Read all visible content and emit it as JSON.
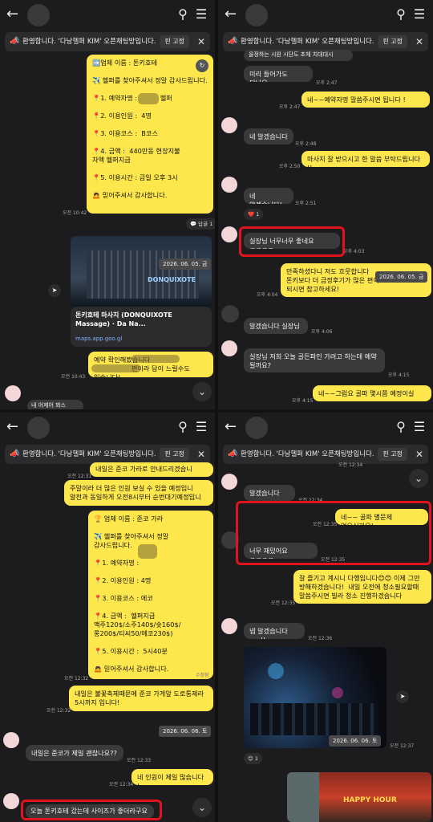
{
  "notice": {
    "text": "환영합니다. '다낭헬퍼 KIM' 오픈채팅방입니다.",
    "pin": "핀 고정"
  },
  "p1": {
    "card": "➡️업체 이름 : 돈키호테\n\n✈️ 헬퍼를 찾아주셔서 정말 감사드립니다.\n\n📍1. 예약자명 :           헬퍼\n\n📍2. 이용인원 :  4명\n\n📍3. 이용코스 :  B코스\n\n📍4. 금액 :  440만동 현장지불\n차액 헬퍼지급\n\n📍5. 이용시간 : 금일 오후 3시\n\n🙇 믿어주셔서 감사합니다.",
    "t_card": "오전 10:42",
    "reply": "💬 답글 1",
    "date_overlay": "2026. 06. 05. 금",
    "photo_sign": "DONQUIXOTE",
    "link_title": "돈키호테 마사지 (DONQUIXOTE Massage) · Da Na...",
    "link_url": "maps.app.goo.gl",
    "msg2": "예약 확인해봤습니다\n                  편이라 답이 느릴수도 있습니다!",
    "t_msg2": "오전 10:43",
    "cut": "내 어제어 봐스"
  },
  "p2": {
    "top_cut": "을정하는 시원 시단도 초체 치대대시",
    "m1": "미리 들어가도 되나요",
    "t_m1": "오후 2:47",
    "m2": "네~~예약자명 말씀주시면 됩니다 !",
    "t_m2": "오후 2:47",
    "m3": "네 알겠습니다",
    "t_m3": "오후 2:48",
    "m4": "마사지 잘 받으시고 한 말씀 부탁드립니다 !!",
    "t_m4": "오후 2:50",
    "m5": "네 알겠습니다!",
    "t_m5": "오후 2:51",
    "react1": "❤️ 1",
    "m6": "실장님 너무너무 좋네요 ㅋㅋㅋㅋ",
    "t_m6": "오후 4:03",
    "m7": "만족하셨다니 저도 흐뭇합니다\n돈키보다 더 금정후기가 많은 편이고\n되시면 참고하세요!",
    "date_overlay": "2026. 06. 05. 금",
    "t_m7": "오후 4:04",
    "m8": "알겠습니다 실장님~",
    "t_m8": "오후 4:06",
    "m9": "실장님 저희 오늘 골든파인 가려고 하는데 예약\n될까요?",
    "t_m9": "오후 4:15",
    "m10": "네~~그럼요 골파 몇시쯤 예정이실",
    "t_m10": "오후 4:15"
  },
  "p3": {
    "m1": "내일은 준코 가라로 안내드리겠습니",
    "t_m1": "오전 12:31",
    "m2": "주말이라 더 많은 인원 보실 수 있을 예정입니\n알천과 동일하게 오전8시부터 순번대기예정입니",
    "card": "🏆 업체 이름 : 준코 가라\n\n✈️ 헬퍼를 찾아주셔서 정말 감사드립니다.\n\n📍1. 예약자명 :\n\n📍2. 이용인원 : 4명\n\n📍3. 이용코스 : 에코\n\n📍4. 금액 :  헬퍼지급\n맥주120$/소주140$/숏160$/\n롱200$/티씨50/에코230$)\n\n📍5. 이용시간 :  5시40분\n\n🙇 믿어주셔서 감사합니다.",
    "edited": "수정됨",
    "t_card": "오전 12:32",
    "m3": "내일은 불꽃축제때문에 준코 가게앞 도로통제라\n5시까지 입니다!",
    "t_m3": "오전 12:32",
    "date_overlay": "2026. 06. 06. 토",
    "m4": "내일은 준코가 제일 괜찮나요??",
    "t_m4": "오전 12:33",
    "m5": "네 인원이 제일 많습니다 !",
    "t_m5": "오전 12:34",
    "m6": "오늘 돈키호테 갔는데 사이즈가 좋더라구요"
  },
  "p4": {
    "top_cut": "오전 12:34",
    "m1": "알겠습니다~~",
    "t_m1": "오전 12:34",
    "m2": "네~~ 골파 별문제 없으신가요!",
    "t_m2": "오전 12:35",
    "m3": "너무 재밌어요 ㅋㅋㅋㅋ",
    "t_m3": "오전 12:35",
    "m4": "잘 즐기고 계시니 다행입니다😊😊 이제 그만\n방해하겠습니다!  내일 오전에 청소필요할때\n말씀주시면 빌라 청소 진행하겠습니다",
    "t_m4": "오전 12:35",
    "m5": "넵 알겠습니다~~!!",
    "t_m5": "오전 12:36",
    "date_overlay": "2026. 06. 06. 토",
    "t_photo": "오전 12:37",
    "react1": "😊 1",
    "sign_text": "HAPPY HOUR"
  },
  "colors": {
    "yellow": "#fde74c",
    "gray": "#3a3a3c",
    "red": "#e0141e",
    "bg": "#1c1c1e"
  },
  "icons": [
    "back-arrow-icon",
    "search-icon",
    "menu-icon",
    "megaphone-icon",
    "close-icon",
    "share-icon",
    "chevron-down-icon"
  ]
}
